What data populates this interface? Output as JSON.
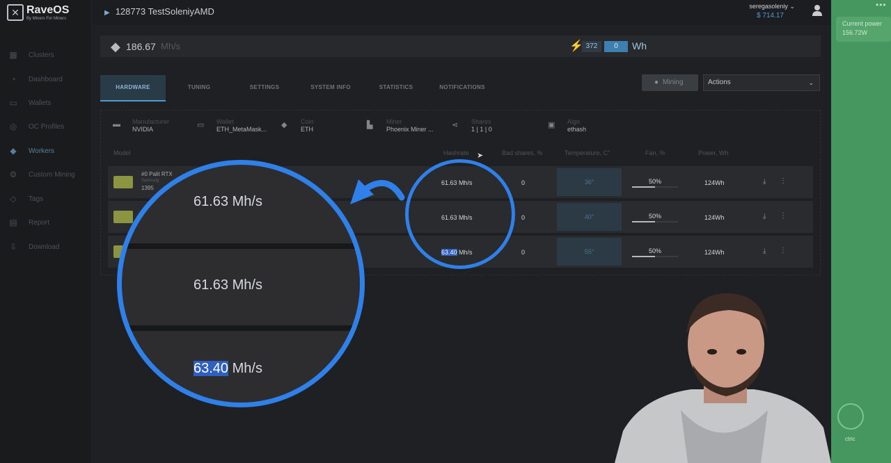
{
  "brand": {
    "name": "RaveOS",
    "tagline": "By Miners For Miners"
  },
  "sidebar": {
    "items": [
      {
        "label": "Clusters",
        "icon": "grid-icon",
        "glyph": "▦"
      },
      {
        "label": "Dashboard",
        "icon": "gauge-icon",
        "glyph": "◔"
      },
      {
        "label": "Wallets",
        "icon": "folder-icon",
        "glyph": "▭"
      },
      {
        "label": "OC Profiles",
        "icon": "dial-icon",
        "glyph": "◎"
      },
      {
        "label": "Workers",
        "icon": "drop-icon",
        "glyph": "◆"
      },
      {
        "label": "Custom Mining",
        "icon": "gear-icon",
        "glyph": "⚙"
      },
      {
        "label": "Tags",
        "icon": "tag-icon",
        "glyph": "◇"
      },
      {
        "label": "Report",
        "icon": "report-icon",
        "glyph": "▤"
      },
      {
        "label": "Download",
        "icon": "download-icon",
        "glyph": "⇩"
      }
    ]
  },
  "header": {
    "worker_title": "128773 TestSoleniyAMD",
    "username": "seregasoleniy",
    "balance": "$ 714.17"
  },
  "right_panel": {
    "current_power_label": "Current power",
    "current_power_value": "156.72W",
    "electric_label": "ctric"
  },
  "summary": {
    "hashrate_value": "186.67",
    "hashrate_unit": "Mh/s",
    "power_value": "372",
    "power_cost": "0",
    "power_unit": "Wh"
  },
  "tabs": [
    {
      "label": "HARDWARE",
      "active": true
    },
    {
      "label": "TUNING"
    },
    {
      "label": "SETTINGS"
    },
    {
      "label": "SYSTEM INFO"
    },
    {
      "label": "STATISTICS"
    },
    {
      "label": "NOTIFICATIONS"
    }
  ],
  "toolbar": {
    "mining_label": "Mining",
    "actions_label": "Actions"
  },
  "info": {
    "manufacturer_label": "Manufacturer",
    "manufacturer": "NVIDIA",
    "wallet_label": "Wallet",
    "wallet": "ETH_MetaMask...",
    "coin_label": "Coin",
    "coin": "ETH",
    "miner_label": "Miner",
    "miner": "Phoenix Miner ...",
    "shares_label": "Shares",
    "shares": "1 | 1 | 0",
    "algo_label": "Algo",
    "algo": "ethash"
  },
  "table": {
    "headers": {
      "model": "Model",
      "hashrate": "Hashrate",
      "bad_shares": "Bad shares, %",
      "temperature": "Temperature, C°",
      "fan": "Fan, %",
      "power": "Power, Wh"
    },
    "rows": [
      {
        "name": "#0 Palit RTX",
        "sub": "Samsung",
        "sub2": "1395",
        "hashrate": "61.63 Mh/s",
        "bad_shares": "0",
        "temperature": "36°",
        "fan": "50%",
        "fan_level": 0.5,
        "power": "124Wh"
      },
      {
        "name": "",
        "sub": "",
        "sub2": "",
        "hashrate": "61.63 Mh/s",
        "bad_shares": "0",
        "temperature": "40°",
        "fan": "50%",
        "fan_level": 0.5,
        "power": "124Wh"
      },
      {
        "name": "",
        "sub": "",
        "sub2": "",
        "hashrate_highlight": "63.40",
        "hashrate_unit": " Mh/s",
        "bad_shares": "0",
        "temperature": "55°",
        "fan": "50%",
        "fan_level": 0.5,
        "power": "124Wh"
      }
    ]
  },
  "zoom": {
    "row1": "61.63 Mh/s",
    "row2": "61.63 Mh/s",
    "row3_highlight": "63.40",
    "row3_unit": " Mh/s"
  },
  "colors": {
    "accent": "#2f80e8",
    "green_panel": "#46975f",
    "highlight": "#2f5fbf"
  }
}
